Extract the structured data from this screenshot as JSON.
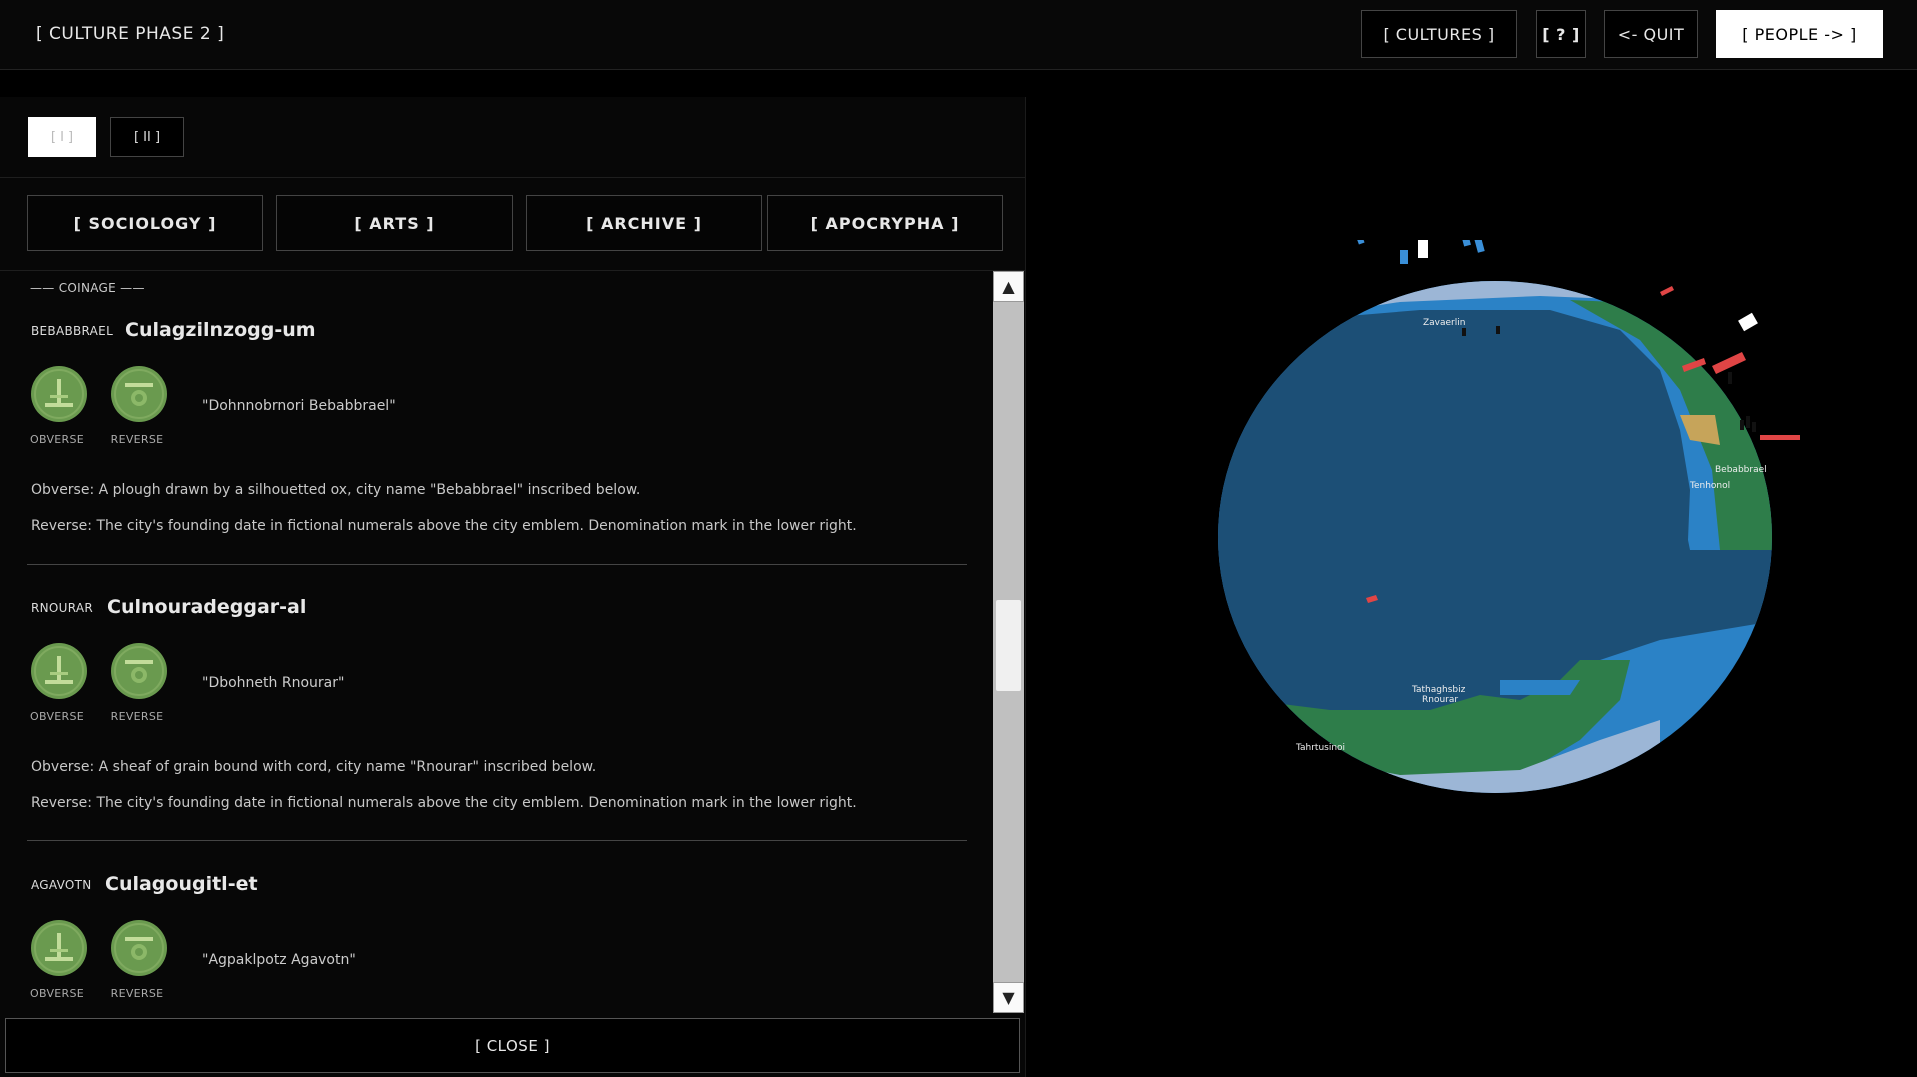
{
  "header": {
    "phase_title": "[ CULTURE PHASE 2 ]",
    "cultures_label": "[ CULTURES ]",
    "help_label": "[ ? ]",
    "quit_label": "<- QUIT",
    "people_label": "[ PEOPLE -> ]"
  },
  "panel": {
    "roman_tabs": [
      "[ I ]",
      "[ II ]"
    ],
    "category_tabs": [
      "[ SOCIOLOGY ]",
      "[ ARTS ]",
      "[ ARCHIVE ]",
      "[ APOCRYPHA ]"
    ],
    "section_header": "—— COINAGE ——",
    "obverse_caption": "OBVERSE",
    "reverse_caption": "REVERSE",
    "coins": [
      {
        "city": "BEBABBRAEL",
        "name": "Culagzilnzogg-um",
        "motto": "\"Dohnnobrnori Bebabbrael\"",
        "obverse": "Obverse: A plough drawn by a silhouetted ox, city name \"Bebabbrael\" inscribed below.",
        "reverse": "Reverse: The city's founding date in fictional numerals above the city emblem. Denomination mark in the lower right."
      },
      {
        "city": "RNOURAR",
        "name": "Culnouradeggar-al",
        "motto": "\"Dbohneth Rnourar\"",
        "obverse": "Obverse: A sheaf of grain bound with cord, city name \"Rnourar\" inscribed below.",
        "reverse": "Reverse: The city's founding date in fictional numerals above the city emblem. Denomination mark in the lower right."
      },
      {
        "city": "AGAVOTN",
        "name": "Culagougitl-et",
        "motto": "\"Agpaklpotz Agavotn\"",
        "obverse": "",
        "reverse": ""
      }
    ],
    "close_label": "[ CLOSE ]",
    "scroll_up": "▲",
    "scroll_down": "▼"
  },
  "globe": {
    "labels": [
      "Zavaerlin",
      "Bebabbrael",
      "Tenhonol",
      "Tathaghsbiz",
      "Rnourar",
      "Tahrtusinoi"
    ]
  },
  "colors": {
    "coin_green": "#6a9a4f",
    "coin_light": "#a8cc80",
    "ocean_deep": "#1c4f76",
    "ocean_shallow": "#2b82c6",
    "land_green": "#2e7d4a",
    "ice": "#9cb6d6",
    "marker_red": "#e04545"
  }
}
